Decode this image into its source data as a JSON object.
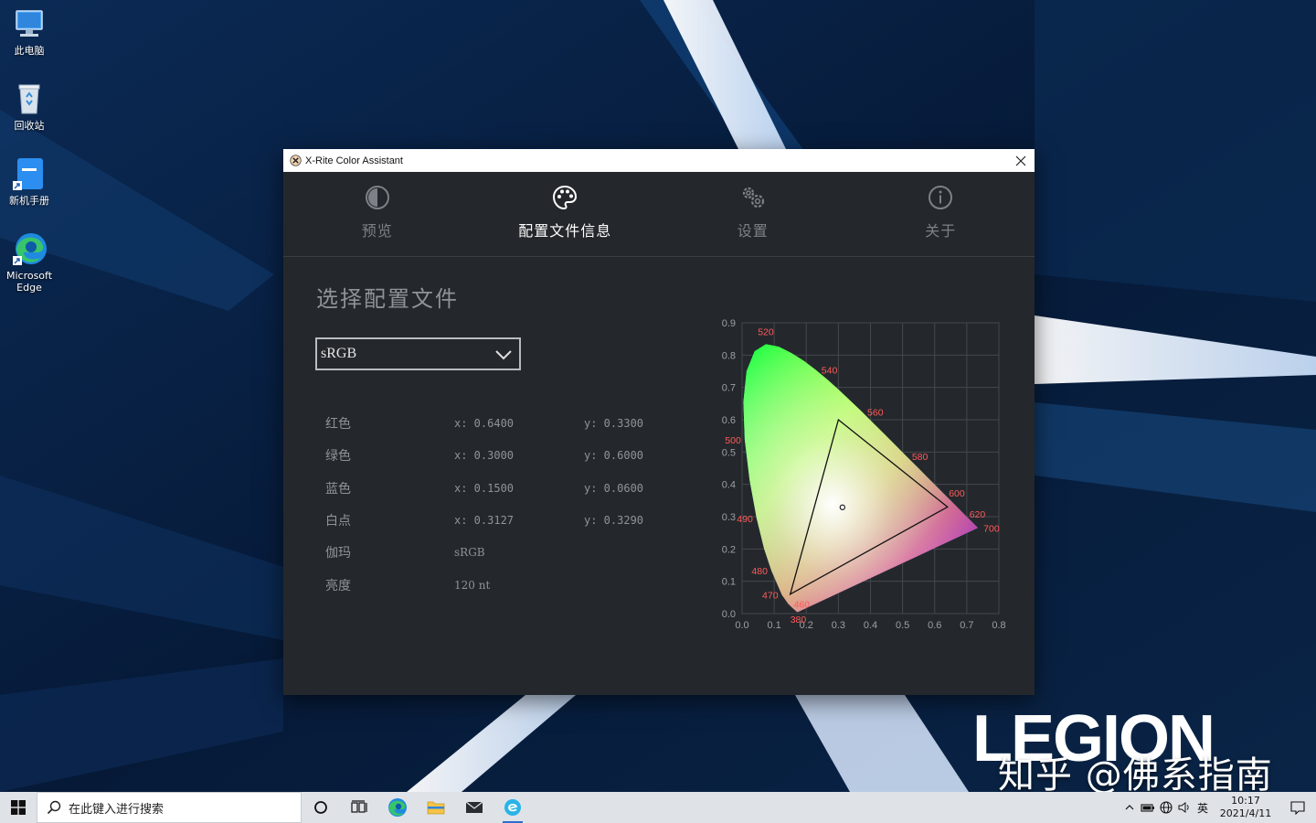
{
  "desktop": {
    "icons": [
      {
        "label": "此电脑"
      },
      {
        "label": "回收站"
      },
      {
        "label": "新机手册"
      },
      {
        "label": "Microsoft Edge"
      }
    ],
    "brand_logo": "LEGION",
    "watermark": "知乎 @佛系指南"
  },
  "window": {
    "title": "X-Rite Color Assistant",
    "tabs": [
      {
        "label": "预览",
        "icon": "contrast-icon",
        "active": false
      },
      {
        "label": "配置文件信息",
        "icon": "palette-icon",
        "active": true
      },
      {
        "label": "设置",
        "icon": "gears-icon",
        "active": false
      },
      {
        "label": "关于",
        "icon": "info-icon",
        "active": false
      }
    ],
    "section_title": "选择配置文件",
    "profile_select": {
      "value": "sRGB"
    },
    "properties": [
      {
        "label": "红色",
        "x": "x: 0.6400",
        "y": "y: 0.3300"
      },
      {
        "label": "绿色",
        "x": "x: 0.3000",
        "y": "y: 0.6000"
      },
      {
        "label": "蓝色",
        "x": "x: 0.1500",
        "y": "y: 0.0600"
      },
      {
        "label": "白点",
        "x": "x: 0.3127",
        "y": "y: 0.3290"
      },
      {
        "label": "伽玛",
        "value": "sRGB"
      },
      {
        "label": "亮度",
        "value": "120 nt"
      }
    ]
  },
  "chart_data": {
    "type": "scatter",
    "title": "",
    "xlabel": "",
    "ylabel": "",
    "xlim": [
      0.0,
      0.8
    ],
    "ylim": [
      0.0,
      0.9
    ],
    "x_ticks": [
      "0.0",
      "0.1",
      "0.2",
      "0.3",
      "0.4",
      "0.5",
      "0.6",
      "0.7",
      "0.8"
    ],
    "y_ticks": [
      "0.0",
      "0.1",
      "0.2",
      "0.3",
      "0.4",
      "0.5",
      "0.6",
      "0.7",
      "0.8",
      "0.9"
    ],
    "grid": true,
    "gamut_triangle": [
      {
        "x": 0.64,
        "y": 0.33
      },
      {
        "x": 0.3,
        "y": 0.6
      },
      {
        "x": 0.15,
        "y": 0.06
      }
    ],
    "white_point": {
      "x": 0.3127,
      "y": 0.329
    },
    "wavelength_labels": [
      {
        "label": "520",
        "x": 0.074,
        "y": 0.834
      },
      {
        "label": "540",
        "x": 0.23,
        "y": 0.754
      },
      {
        "label": "560",
        "x": 0.373,
        "y": 0.624
      },
      {
        "label": "580",
        "x": 0.512,
        "y": 0.487
      },
      {
        "label": "600",
        "x": 0.627,
        "y": 0.373
      },
      {
        "label": "620",
        "x": 0.691,
        "y": 0.308
      },
      {
        "label": "700",
        "x": 0.735,
        "y": 0.265
      },
      {
        "label": "500",
        "x": 0.008,
        "y": 0.538
      },
      {
        "label": "490",
        "x": 0.045,
        "y": 0.295
      },
      {
        "label": "480",
        "x": 0.091,
        "y": 0.133
      },
      {
        "label": "470",
        "x": 0.124,
        "y": 0.058
      },
      {
        "label": "460",
        "x": 0.144,
        "y": 0.03
      },
      {
        "label": "380",
        "x": 0.175,
        "y": 0.005
      }
    ],
    "label_color": "#ff5a5a"
  },
  "taskbar": {
    "search_placeholder": "在此键入进行搜索",
    "ime": "英",
    "time": "10:17",
    "date": "2021/4/11"
  }
}
